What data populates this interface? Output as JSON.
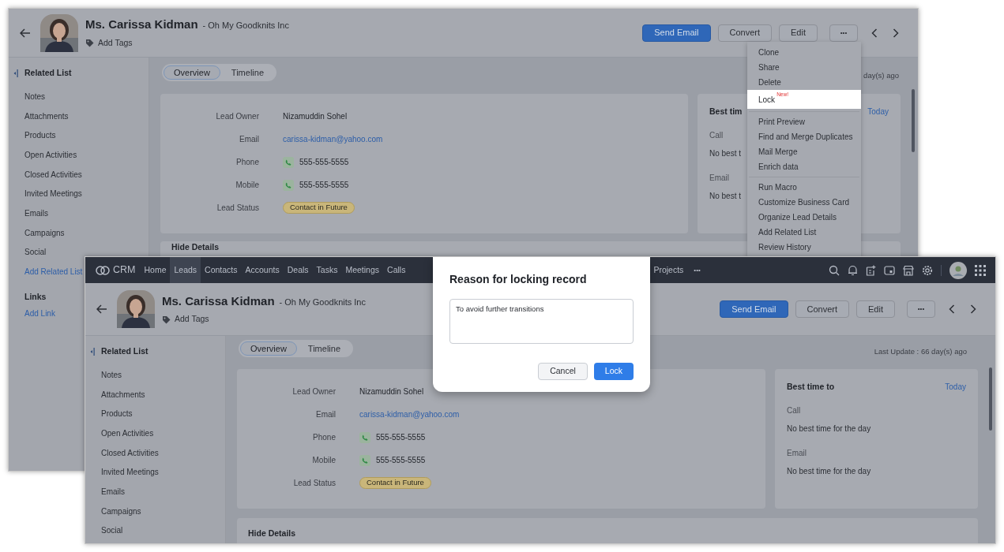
{
  "back_window": {
    "record": {
      "name": "Ms. Carissa Kidman",
      "company": "- Oh My Goodknits Inc",
      "add_tags": "Add Tags"
    },
    "buttons": [
      {
        "label": "Send Email",
        "kind": "primary"
      },
      {
        "label": "Convert",
        "kind": "secondary"
      },
      {
        "label": "Edit",
        "kind": "secondary"
      },
      {
        "label": "•••",
        "kind": "more"
      }
    ],
    "related_list": {
      "title": "Related List",
      "items": [
        {
          "label": "Notes",
          "kind": "item"
        },
        {
          "label": "Attachments",
          "kind": "item"
        },
        {
          "label": "Products",
          "kind": "item"
        },
        {
          "label": "Open Activities",
          "kind": "item"
        },
        {
          "label": "Closed Activities",
          "kind": "item"
        },
        {
          "label": "Invited Meetings",
          "kind": "item"
        },
        {
          "label": "Emails",
          "kind": "item"
        },
        {
          "label": "Campaigns",
          "kind": "item"
        },
        {
          "label": "Social",
          "kind": "item"
        },
        {
          "label": "Add Related List",
          "kind": "link"
        }
      ]
    },
    "links": {
      "title": "Links",
      "items": [
        {
          "label": "Add Link",
          "kind": "link"
        }
      ]
    },
    "tabs": [
      {
        "label": "Overview",
        "selected": true
      },
      {
        "label": "Timeline",
        "selected": false
      }
    ],
    "last_update": "day(s) ago",
    "fields": [
      {
        "label": "Lead Owner",
        "value": "Nizamuddin Sohel",
        "kind": "text"
      },
      {
        "label": "Email",
        "value": "carissa-kidman@yahoo.com",
        "kind": "link"
      },
      {
        "label": "Phone",
        "value": "555-555-5555",
        "kind": "phone"
      },
      {
        "label": "Mobile",
        "value": "555-555-5555",
        "kind": "phone"
      },
      {
        "label": "Lead Status",
        "value": "Contact in Future",
        "kind": "badge"
      }
    ],
    "best_time": {
      "title": "Best tim",
      "today": "Today",
      "items": [
        {
          "label": "Call",
          "value": "No best t"
        },
        {
          "label": "Email",
          "value": "No best t"
        }
      ]
    },
    "hide_details": "Hide Details",
    "more_menu": {
      "groups": [
        [
          {
            "label": "Clone",
            "selected": false
          },
          {
            "label": "Share",
            "selected": false
          },
          {
            "label": "Delete",
            "selected": false
          },
          {
            "label": "Lock",
            "badge": "New!",
            "selected": true
          }
        ],
        [
          {
            "label": "Print Preview",
            "selected": false
          },
          {
            "label": "Find and Merge Duplicates",
            "selected": false
          },
          {
            "label": "Mail Merge",
            "selected": false
          },
          {
            "label": "Enrich data",
            "selected": false
          }
        ],
        [
          {
            "label": "Run Macro",
            "selected": false
          },
          {
            "label": "Customize Business Card",
            "selected": false
          },
          {
            "label": "Organize Lead Details",
            "selected": false
          },
          {
            "label": "Add Related List",
            "selected": false
          },
          {
            "label": "Review History",
            "selected": false
          }
        ]
      ]
    }
  },
  "front_window": {
    "nav": {
      "logo": "CRM",
      "items": [
        {
          "label": "Home",
          "selected": false
        },
        {
          "label": "Leads",
          "selected": true
        },
        {
          "label": "Contacts",
          "selected": false
        },
        {
          "label": "Accounts",
          "selected": false
        },
        {
          "label": "Deals",
          "selected": false
        },
        {
          "label": "Tasks",
          "selected": false
        },
        {
          "label": "Meetings",
          "selected": false
        },
        {
          "label": "Calls",
          "selected": false
        }
      ],
      "more_items": [
        {
          "label": "Projects",
          "selected": false
        }
      ],
      "more": "•••"
    },
    "record": {
      "name": "Ms. Carissa Kidman",
      "company": "- Oh My Goodknits Inc",
      "add_tags": "Add Tags"
    },
    "buttons": [
      {
        "label": "Send Email",
        "kind": "primary"
      },
      {
        "label": "Convert",
        "kind": "secondary"
      },
      {
        "label": "Edit",
        "kind": "secondary"
      },
      {
        "label": "•••",
        "kind": "more"
      }
    ],
    "related_list": {
      "title": "Related List",
      "items": [
        {
          "label": "Notes",
          "kind": "item"
        },
        {
          "label": "Attachments",
          "kind": "item"
        },
        {
          "label": "Products",
          "kind": "item"
        },
        {
          "label": "Open Activities",
          "kind": "item"
        },
        {
          "label": "Closed Activities",
          "kind": "item"
        },
        {
          "label": "Invited Meetings",
          "kind": "item"
        },
        {
          "label": "Emails",
          "kind": "item"
        },
        {
          "label": "Campaigns",
          "kind": "item"
        },
        {
          "label": "Social",
          "kind": "item"
        }
      ]
    },
    "tabs": [
      {
        "label": "Overview",
        "selected": true
      },
      {
        "label": "Timeline",
        "selected": false
      }
    ],
    "last_update": "Last Update : 66 day(s) ago",
    "fields": [
      {
        "label": "Lead Owner",
        "value": "Nizamuddin Sohel",
        "kind": "text"
      },
      {
        "label": "Email",
        "value": "carissa-kidman@yahoo.com",
        "kind": "link"
      },
      {
        "label": "Phone",
        "value": "555-555-5555",
        "kind": "phone"
      },
      {
        "label": "Mobile",
        "value": "555-555-5555",
        "kind": "phone"
      },
      {
        "label": "Lead Status",
        "value": "Contact in Future",
        "kind": "badge"
      }
    ],
    "best_time": {
      "title": "Best time to",
      "today": "Today",
      "items": [
        {
          "label": "Call",
          "value": "No best time for the day"
        },
        {
          "label": "Email",
          "value": "No best time for the day"
        }
      ]
    },
    "hide_details": "Hide Details",
    "dialog": {
      "title": "Reason for locking record",
      "reason": "To avoid further transitions",
      "buttons": [
        {
          "label": "Cancel",
          "kind": "secondary"
        },
        {
          "label": "Lock",
          "kind": "primary"
        }
      ]
    }
  }
}
